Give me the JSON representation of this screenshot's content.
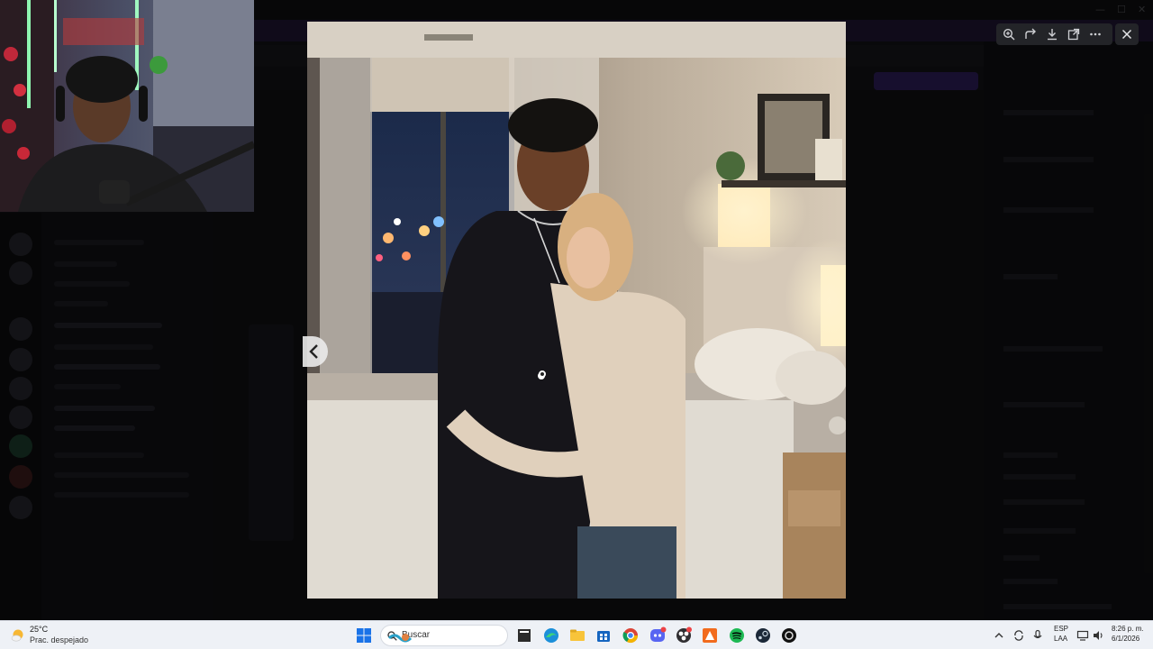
{
  "viewer": {
    "toolbar_icons": [
      "zoom-in-icon",
      "rotate-icon",
      "download-icon",
      "open-external-icon",
      "more-icon"
    ],
    "close_icon": "close-icon",
    "prev_icon": "chevron-left-icon"
  },
  "taskbar": {
    "weather": {
      "temp": "25°C",
      "desc": "Prac. despejado",
      "icon": "weather-partly-cloudy-icon"
    },
    "search": {
      "placeholder": "Buscar"
    },
    "apps": [
      "windows-start-icon",
      "file-explorer-dark-icon",
      "edge-icon",
      "folder-icon",
      "store-icon",
      "chrome-icon",
      "discord-icon",
      "obs-icon",
      "app-orange-icon",
      "spotify-icon",
      "steam-icon",
      "app-dark-icon"
    ],
    "tray": {
      "lang_line1": "ESP",
      "lang_line2": "LAA",
      "time": "8:26 p. m.",
      "date": "6/1/2026"
    }
  },
  "colors": {
    "taskbar_bg": "#eef1f6",
    "toolbar_bg": "#232428",
    "accent_purple": "#1e1430"
  }
}
